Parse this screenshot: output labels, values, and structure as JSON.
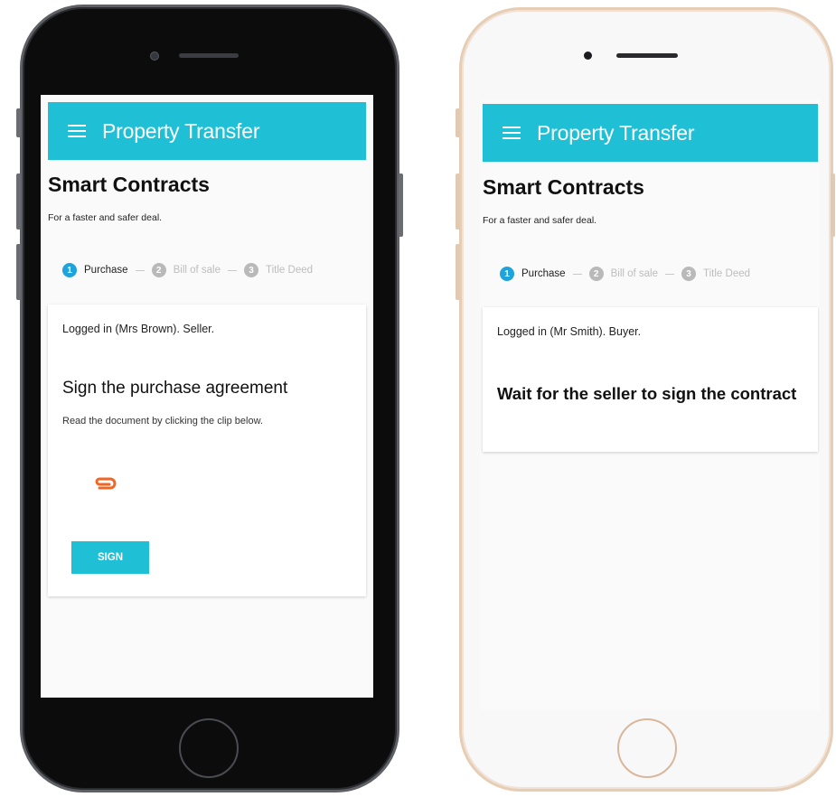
{
  "left_phone": {
    "app_bar": {
      "title": "Property Transfer"
    },
    "page_title": "Smart Contracts",
    "page_subtitle": "For a faster and safer deal.",
    "steps": [
      {
        "number": "1",
        "label": "Purchase",
        "state": "active"
      },
      {
        "number": "2",
        "label": "Bill of sale",
        "state": "inactive"
      },
      {
        "number": "3",
        "label": "Title Deed",
        "state": "inactive"
      }
    ],
    "card": {
      "status": "Logged in (Mrs Brown). Seller.",
      "heading": "Sign the purchase agreement",
      "instruction": "Read the document by clicking the clip below.",
      "attachment_icon": "paperclip-icon",
      "sign_label": "SIGN"
    }
  },
  "right_phone": {
    "app_bar": {
      "title": "Property Transfer"
    },
    "page_title": "Smart Contracts",
    "page_subtitle": "For a faster and safer deal.",
    "steps": [
      {
        "number": "1",
        "label": "Purchase",
        "state": "active"
      },
      {
        "number": "2",
        "label": "Bill of sale",
        "state": "inactive"
      },
      {
        "number": "3",
        "label": "Title Deed",
        "state": "inactive"
      }
    ],
    "card": {
      "status": "Logged in (Mr Smith). Buyer.",
      "heading": "Wait for the seller to sign the contract"
    }
  },
  "colors": {
    "accent": "#1fc0d6",
    "step_active": "#1fa3dc",
    "step_inactive": "#b9b9b9",
    "clip": "#f26522",
    "dark_phone": "#0c0c0d",
    "light_phone_frame": "#e6cdb6"
  }
}
